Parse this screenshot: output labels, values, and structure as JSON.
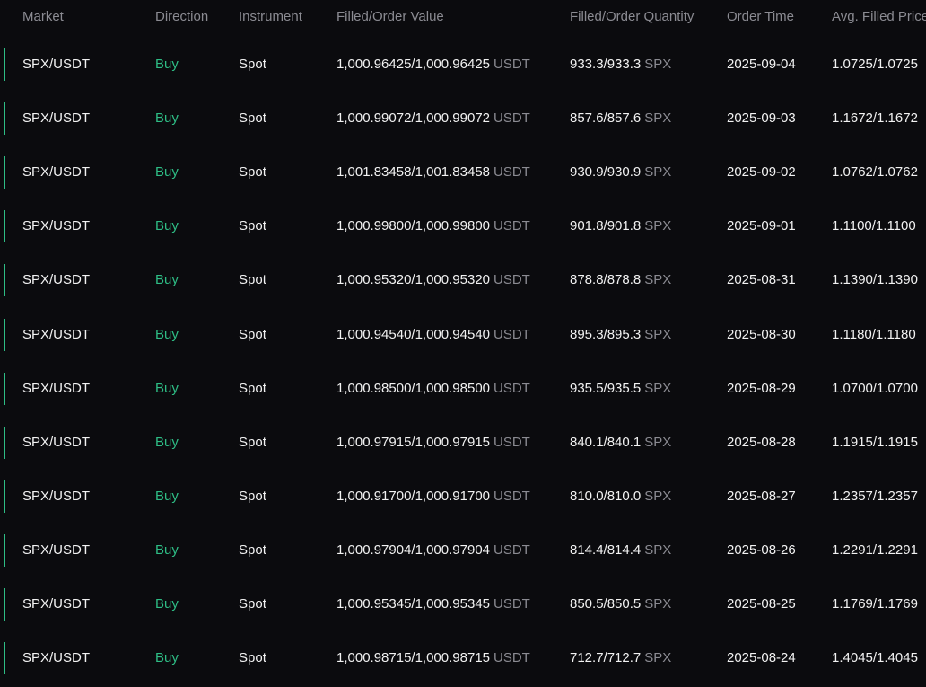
{
  "columns": {
    "market": "Market",
    "direction": "Direction",
    "instrument": "Instrument",
    "value": "Filled/Order Value",
    "quantity": "Filled/Order Quantity",
    "time": "Order Time",
    "price": "Avg. Filled Price"
  },
  "colors": {
    "buy": "#2ebd85",
    "muted": "#8b8b92",
    "background": "#0b0b0e"
  },
  "rows": [
    {
      "market": "SPX/USDT",
      "direction": "Buy",
      "instrument": "Spot",
      "value": "1,000.96425/1,000.96425",
      "value_unit": "USDT",
      "quantity": "933.3/933.3",
      "quantity_unit": "SPX",
      "time": "2025-09-04",
      "price": "1.0725/1.0725"
    },
    {
      "market": "SPX/USDT",
      "direction": "Buy",
      "instrument": "Spot",
      "value": "1,000.99072/1,000.99072",
      "value_unit": "USDT",
      "quantity": "857.6/857.6",
      "quantity_unit": "SPX",
      "time": "2025-09-03",
      "price": "1.1672/1.1672"
    },
    {
      "market": "SPX/USDT",
      "direction": "Buy",
      "instrument": "Spot",
      "value": "1,001.83458/1,001.83458",
      "value_unit": "USDT",
      "quantity": "930.9/930.9",
      "quantity_unit": "SPX",
      "time": "2025-09-02",
      "price": "1.0762/1.0762"
    },
    {
      "market": "SPX/USDT",
      "direction": "Buy",
      "instrument": "Spot",
      "value": "1,000.99800/1,000.99800",
      "value_unit": "USDT",
      "quantity": "901.8/901.8",
      "quantity_unit": "SPX",
      "time": "2025-09-01",
      "price": "1.1100/1.1100"
    },
    {
      "market": "SPX/USDT",
      "direction": "Buy",
      "instrument": "Spot",
      "value": "1,000.95320/1,000.95320",
      "value_unit": "USDT",
      "quantity": "878.8/878.8",
      "quantity_unit": "SPX",
      "time": "2025-08-31",
      "price": "1.1390/1.1390"
    },
    {
      "market": "SPX/USDT",
      "direction": "Buy",
      "instrument": "Spot",
      "value": "1,000.94540/1,000.94540",
      "value_unit": "USDT",
      "quantity": "895.3/895.3",
      "quantity_unit": "SPX",
      "time": "2025-08-30",
      "price": "1.1180/1.1180"
    },
    {
      "market": "SPX/USDT",
      "direction": "Buy",
      "instrument": "Spot",
      "value": "1,000.98500/1,000.98500",
      "value_unit": "USDT",
      "quantity": "935.5/935.5",
      "quantity_unit": "SPX",
      "time": "2025-08-29",
      "price": "1.0700/1.0700"
    },
    {
      "market": "SPX/USDT",
      "direction": "Buy",
      "instrument": "Spot",
      "value": "1,000.97915/1,000.97915",
      "value_unit": "USDT",
      "quantity": "840.1/840.1",
      "quantity_unit": "SPX",
      "time": "2025-08-28",
      "price": "1.1915/1.1915"
    },
    {
      "market": "SPX/USDT",
      "direction": "Buy",
      "instrument": "Spot",
      "value": "1,000.91700/1,000.91700",
      "value_unit": "USDT",
      "quantity": "810.0/810.0",
      "quantity_unit": "SPX",
      "time": "2025-08-27",
      "price": "1.2357/1.2357"
    },
    {
      "market": "SPX/USDT",
      "direction": "Buy",
      "instrument": "Spot",
      "value": "1,000.97904/1,000.97904",
      "value_unit": "USDT",
      "quantity": "814.4/814.4",
      "quantity_unit": "SPX",
      "time": "2025-08-26",
      "price": "1.2291/1.2291"
    },
    {
      "market": "SPX/USDT",
      "direction": "Buy",
      "instrument": "Spot",
      "value": "1,000.95345/1,000.95345",
      "value_unit": "USDT",
      "quantity": "850.5/850.5",
      "quantity_unit": "SPX",
      "time": "2025-08-25",
      "price": "1.1769/1.1769"
    },
    {
      "market": "SPX/USDT",
      "direction": "Buy",
      "instrument": "Spot",
      "value": "1,000.98715/1,000.98715",
      "value_unit": "USDT",
      "quantity": "712.7/712.7",
      "quantity_unit": "SPX",
      "time": "2025-08-24",
      "price": "1.4045/1.4045"
    }
  ]
}
